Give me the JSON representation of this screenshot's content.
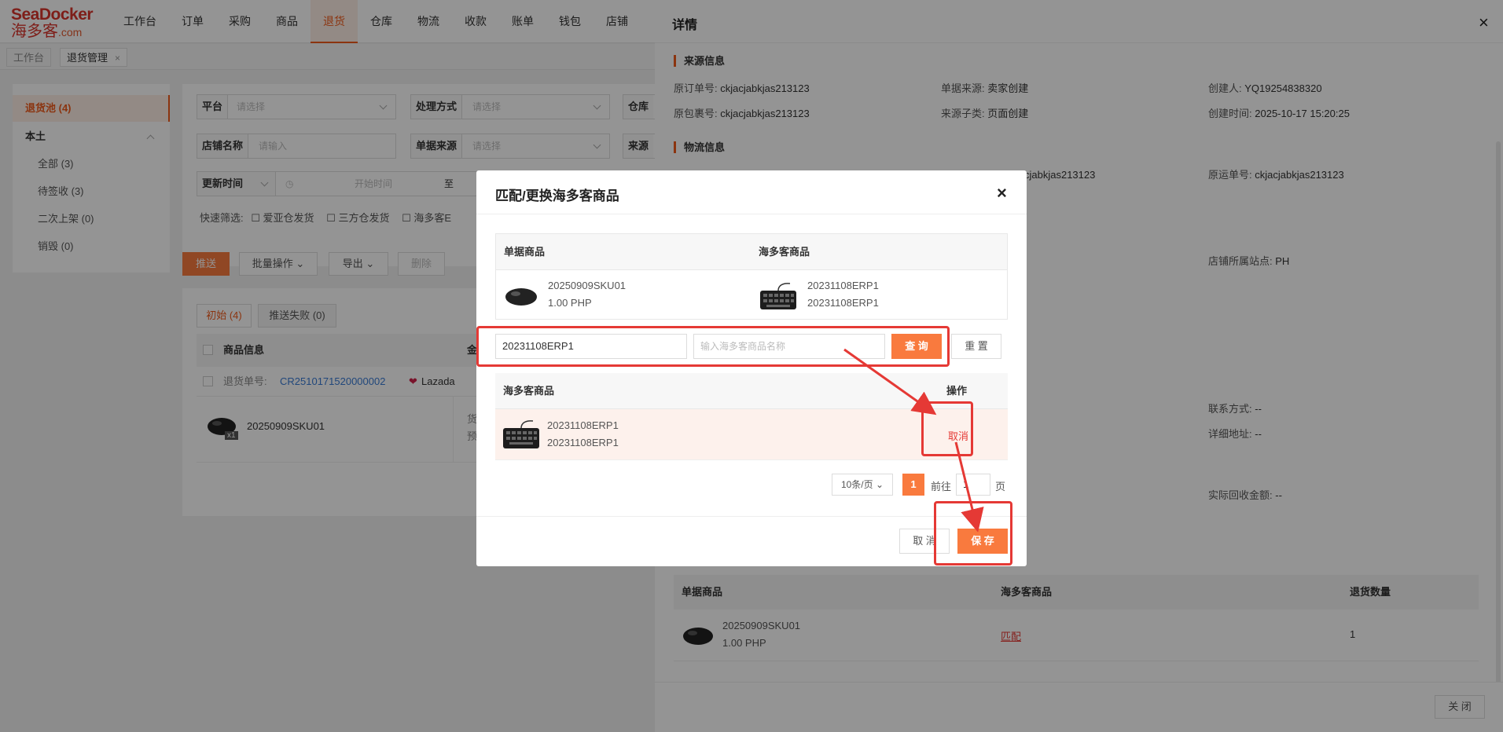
{
  "nav": {
    "logo_top": "SeaDocker",
    "logo_cn": "海多客",
    "logo_domain": ".com",
    "items": [
      "工作台",
      "订单",
      "采购",
      "商品",
      "退货",
      "仓库",
      "物流",
      "收款",
      "账单",
      "钱包",
      "店铺"
    ]
  },
  "tabs": [
    {
      "label": "工作台"
    },
    {
      "label": "退货管理"
    }
  ],
  "sidebar": {
    "pool": "退货池 (4)",
    "group": "本土",
    "items": [
      "全部 (3)",
      "待签收 (3)",
      "二次上架 (0)",
      "销毁 (0)"
    ]
  },
  "filters": {
    "platform_label": "平台",
    "platform_ph": "请选择",
    "method_label": "处理方式",
    "method_ph": "请选择",
    "warehouse_label": "仓库",
    "store_label": "店铺名称",
    "store_ph": "请输入",
    "source_label": "单据来源",
    "source_ph": "请选择",
    "source2_label": "来源",
    "time_label": "更新时间",
    "start_ph": "开始时间",
    "to": "至",
    "quick_label": "快速筛选:",
    "quick": [
      "爱亚仓发货",
      "三方仓发货",
      "海多客E"
    ]
  },
  "toolbar": {
    "push": "推送",
    "batch": "批量操作",
    "export": "导出",
    "delete": "删除"
  },
  "list": {
    "tab_init": "初始 (4)",
    "tab_fail": "推送失败 (0)",
    "col_product": "商品信息",
    "col_amount": "金额",
    "order_label": "退货单号:",
    "order_no": "CR2510171520000002",
    "platform": "Lazada",
    "sku": "20250909SKU01",
    "qty": "x1",
    "value_label": "货值",
    "estimate_label": "预估"
  },
  "drawer": {
    "title": "详情",
    "source_section": "来源信息",
    "orig_order_label": "原订单号:",
    "orig_order": "ckjacjabkjas213123",
    "doc_source_label": "单据来源:",
    "doc_source": "卖家创建",
    "creator_label": "创建人:",
    "creator": "YQ19254838320",
    "orig_pkg_label": "原包裹号:",
    "orig_pkg": "ckjacjabkjas213123",
    "source_sub_label": "来源子类:",
    "source_sub": "页面创建",
    "created_time_label": "创建时间:",
    "created_time": "2025-10-17 15:20:25",
    "logistics_section": "物流信息",
    "logistics_partial": "cjabkjas213123",
    "orig_waybill_label": "原运单号:",
    "orig_waybill": "ckjacjabkjas213123",
    "store_site_label": "店铺所属站点:",
    "store_site": "PH",
    "contact_label": "联系方式:",
    "contact": "--",
    "address_label": "详细地址:",
    "address": "--",
    "recycle_label": "实际回收金额:",
    "recycle": "--",
    "table_cols": [
      "单据商品",
      "海多客商品",
      "退货数量"
    ],
    "row_sku": "20250909SKU01",
    "row_price": "1.00 PHP",
    "row_match": "匹配",
    "row_qty": "1",
    "close": "关 闭"
  },
  "modal": {
    "title": "匹配/更换海多客商品",
    "top_cols": [
      "单据商品",
      "海多客商品"
    ],
    "doc_sku": "20250909SKU01",
    "doc_price": "1.00 PHP",
    "hdk_sku1": "20231108ERP1",
    "hdk_sku2": "20231108ERP1",
    "search_value": "20231108ERP1",
    "search_ph": "输入海多客商品名称",
    "query": "查 询",
    "reset": "重 置",
    "result_cols": [
      "海多客商品",
      "操作"
    ],
    "result_sku1": "20231108ERP1",
    "result_sku2": "20231108ERP1",
    "result_action": "取消",
    "page_size": "10条/页",
    "page_current": "1",
    "goto_label": "前往",
    "goto_value": "1",
    "page_suffix": "页",
    "cancel": "取 消",
    "save": "保 存"
  },
  "colors": {
    "accent": "#f05a1a",
    "highlight": "#e53935",
    "link": "#3a7bd5"
  }
}
